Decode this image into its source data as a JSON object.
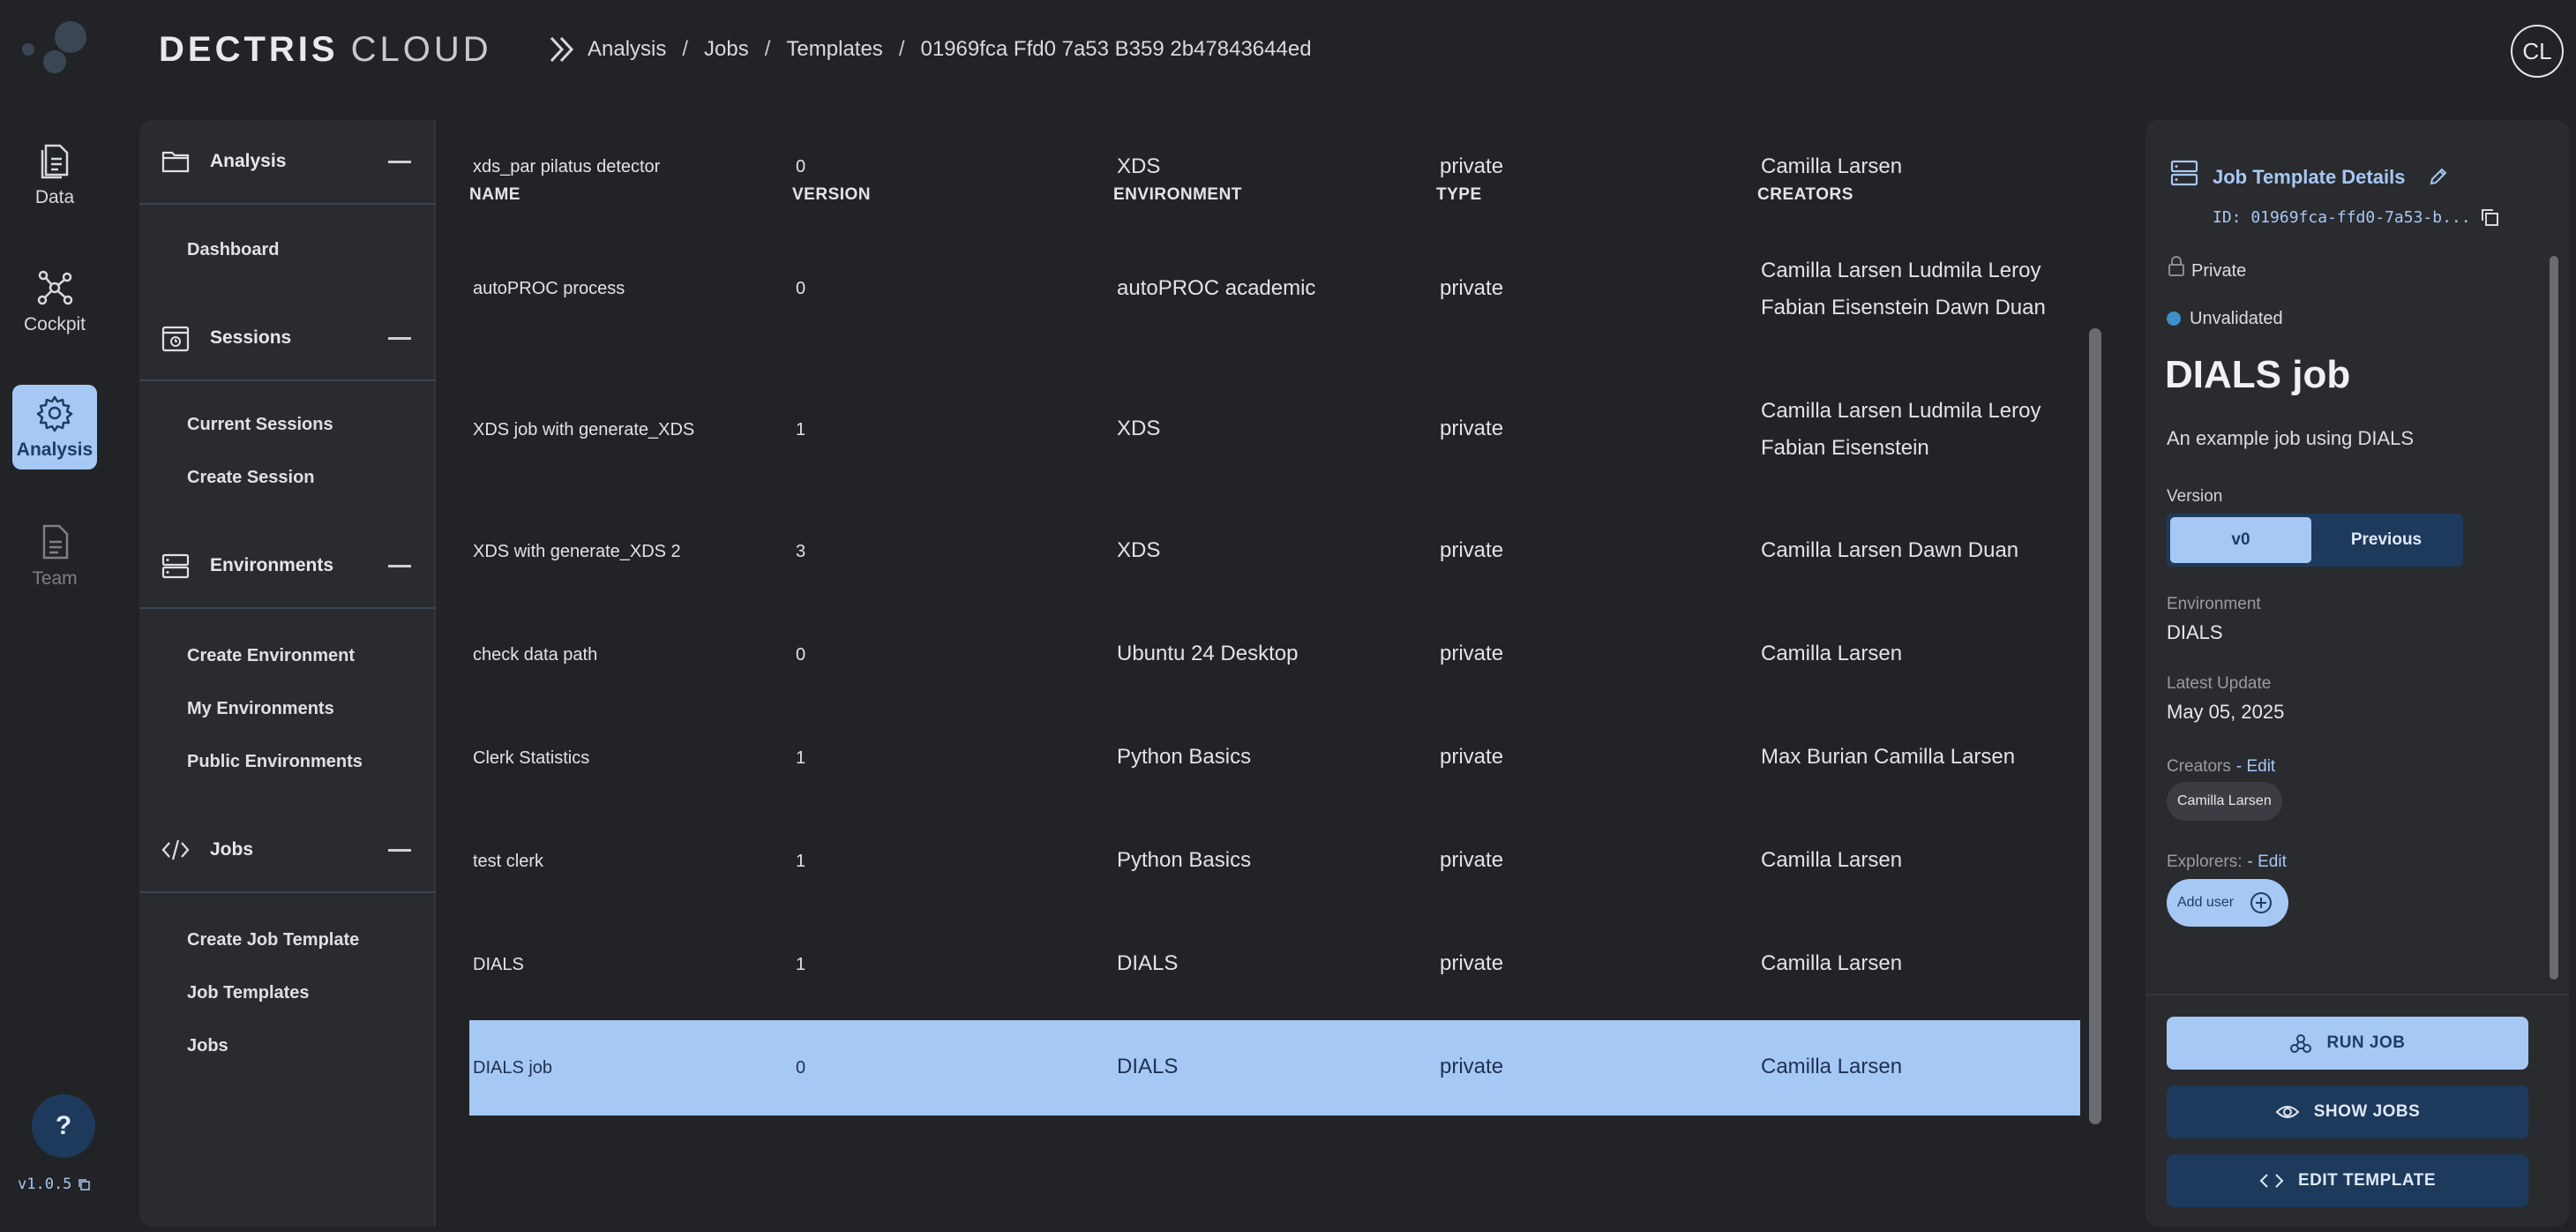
{
  "header": {
    "brand_bold": "DECTRIS",
    "brand_light": "CLOUD",
    "breadcrumb": [
      "Analysis",
      "Jobs",
      "Templates",
      "01969fca Ffd0 7a53 B359 2b47843644ed"
    ],
    "breadcrumb_sep": "/",
    "avatar": "CL"
  },
  "rail": {
    "items": [
      {
        "label": "Data",
        "icon": "document-icon"
      },
      {
        "label": "Cockpit",
        "icon": "network-icon"
      },
      {
        "label": "Analysis",
        "icon": "gear-icon",
        "active": true
      },
      {
        "label": "Team",
        "icon": "document-icon",
        "muted": true
      }
    ],
    "help": "?",
    "version": "v1.0.5"
  },
  "nav": {
    "sections": [
      {
        "title": "Analysis",
        "icon": "folder-icon",
        "links": [
          "Dashboard"
        ]
      },
      {
        "title": "Sessions",
        "icon": "calendar-icon",
        "links": [
          "Current Sessions",
          "Create Session"
        ]
      },
      {
        "title": "Environments",
        "icon": "server-icon",
        "links": [
          "Create Environment",
          "My Environments",
          "Public Environments"
        ]
      },
      {
        "title": "Jobs",
        "icon": "code-icon",
        "links": [
          "Create Job Template",
          "Job Templates",
          "Jobs"
        ]
      }
    ]
  },
  "table": {
    "headers": [
      "NAME",
      "VERSION",
      "ENVIRONMENT",
      "TYPE",
      "CREATORS"
    ],
    "top_row": {
      "name": "xds_par pilatus detector",
      "version": "0",
      "environment": "XDS",
      "type": "private",
      "creators": "Camilla Larsen"
    },
    "rows": [
      {
        "name": "autoPROC process",
        "version": "0",
        "environment": "autoPROC academic",
        "type": "private",
        "creators": "Camilla Larsen Ludmila Leroy Fabian Eisenstein Dawn Duan"
      },
      {
        "name": "XDS job with generate_XDS",
        "version": "1",
        "environment": "XDS",
        "type": "private",
        "creators": "Camilla Larsen Ludmila Leroy Fabian Eisenstein"
      },
      {
        "name": "XDS with generate_XDS 2",
        "version": "3",
        "environment": "XDS",
        "type": "private",
        "creators": "Camilla Larsen Dawn Duan"
      },
      {
        "name": "check data path",
        "version": "0",
        "environment": "Ubuntu 24 Desktop",
        "type": "private",
        "creators": "Camilla Larsen"
      },
      {
        "name": "Clerk Statistics",
        "version": "1",
        "environment": "Python Basics",
        "type": "private",
        "creators": "Max Burian Camilla Larsen"
      },
      {
        "name": "test clerk",
        "version": "1",
        "environment": "Python Basics",
        "type": "private",
        "creators": "Camilla Larsen"
      },
      {
        "name": "DIALS",
        "version": "1",
        "environment": "DIALS",
        "type": "private",
        "creators": "Camilla Larsen"
      },
      {
        "name": "DIALS job",
        "version": "0",
        "environment": "DIALS",
        "type": "private",
        "creators": "Camilla Larsen",
        "selected": true
      }
    ]
  },
  "details": {
    "title": "Job Template Details",
    "id": "ID: 01969fca-ffd0-7a53-b...",
    "visibility": "Private",
    "status": "Unvalidated",
    "status_color": "#3d8fc8",
    "name": "DIALS job",
    "description": "An example job using DIALS",
    "version_label": "Version",
    "version_current": "v0",
    "version_previous": "Previous",
    "environment_label": "Environment",
    "environment": "DIALS",
    "latest_update_label": "Latest Update",
    "latest_update": "May 05, 2025",
    "creators_label": "Creators",
    "creators_edit": "- Edit",
    "creator_chip": "Camilla Larsen",
    "explorers_label": "Explorers:",
    "explorers_edit": "- Edit",
    "add_user": "Add user",
    "run_job": "RUN JOB",
    "show_jobs": "SHOW JOBS",
    "edit_template": "EDIT TEMPLATE"
  },
  "colors": {
    "accent": "#a6c8f5",
    "accent_dark": "#1d3a5c",
    "background": "#222326",
    "panel": "#2a2b2f"
  }
}
